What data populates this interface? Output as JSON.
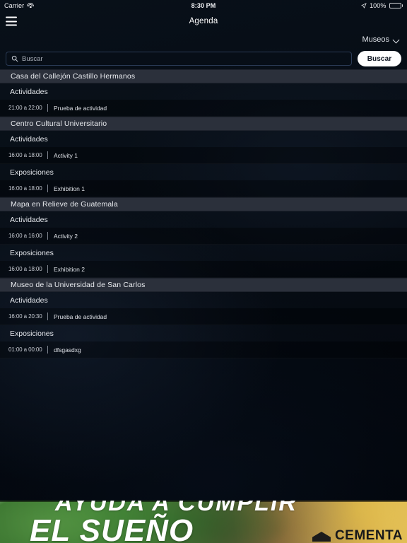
{
  "status_bar": {
    "carrier": "Carrier",
    "wifi_icon": "wifi-icon",
    "time": "8:30 PM",
    "location_icon": "location-arrow-icon",
    "battery_percent": "100%",
    "battery_icon": "battery-full-icon"
  },
  "navbar": {
    "menu_icon": "hamburger-menu-icon",
    "title": "Agenda"
  },
  "filter": {
    "label": "Museos",
    "chevron_icon": "chevron-down-icon"
  },
  "search": {
    "icon": "search-icon",
    "placeholder": "Buscar",
    "value": "",
    "button_label": "Buscar"
  },
  "sections": [
    {
      "name": "Casa del Callejón Castillo Hermanos",
      "groups": [
        {
          "title": "Actividades",
          "events": [
            {
              "time": "21:00 a 22:00",
              "name": "Prueba de actividad"
            }
          ]
        }
      ]
    },
    {
      "name": "Centro Cultural Universitario",
      "groups": [
        {
          "title": "Actividades",
          "events": [
            {
              "time": "16:00 a 18:00",
              "name": "Activity 1"
            }
          ]
        },
        {
          "title": "Exposiciones",
          "events": [
            {
              "time": "16:00 a 18:00",
              "name": "Exhibition 1"
            }
          ]
        }
      ]
    },
    {
      "name": "Mapa en Relieve de Guatemala",
      "groups": [
        {
          "title": "Actividades",
          "events": [
            {
              "time": "16:00 a 16:00",
              "name": "Activity 2"
            }
          ]
        },
        {
          "title": "Exposiciones",
          "events": [
            {
              "time": "16:00 a 18:00",
              "name": "Exhibition 2"
            }
          ]
        }
      ]
    },
    {
      "name": "Museo de la Universidad de San Carlos",
      "groups": [
        {
          "title": "Actividades",
          "events": [
            {
              "time": "16:00 a 20:30",
              "name": "Prueba de actividad"
            }
          ]
        },
        {
          "title": "Exposiciones",
          "events": [
            {
              "time": "01:00 a 00:00",
              "name": "dfsgasdxg"
            }
          ]
        }
      ]
    }
  ],
  "banner": {
    "line1": "AYUDA A CUMPLIR",
    "line2": "EL SUEÑO",
    "brand": "CEMENTA",
    "brand_icon": "roof-logo-icon"
  },
  "colors": {
    "page_background": "#02060b",
    "section_header": "#2b303b",
    "accent_button": "#ffffff",
    "search_border": "#2a3a55",
    "banner_green": "#3d7a32",
    "banner_tan": "#c9a05a"
  }
}
